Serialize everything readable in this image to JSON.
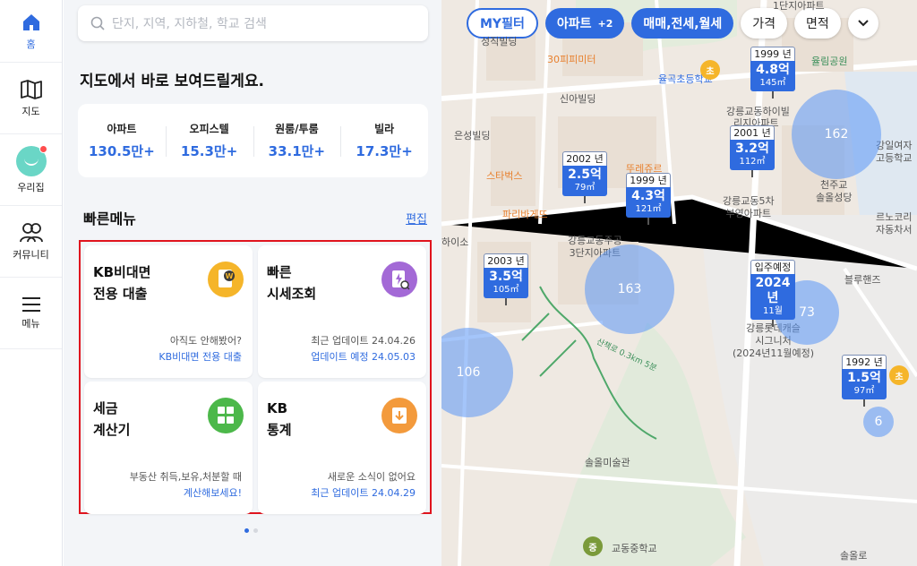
{
  "nav": {
    "items": [
      {
        "label": "홈",
        "icon": "home-icon"
      },
      {
        "label": "지도",
        "icon": "map-icon"
      },
      {
        "label": "우리집",
        "icon": "avatar"
      },
      {
        "label": "커뮤니티",
        "icon": "community-icon"
      },
      {
        "label": "메뉴",
        "icon": "menu-icon"
      }
    ]
  },
  "search": {
    "placeholder": "단지, 지역, 지하철, 학교 검색"
  },
  "headline": "지도에서 바로 보여드릴게요.",
  "stats": [
    {
      "label": "아파트",
      "value": "130.5만+"
    },
    {
      "label": "오피스텔",
      "value": "15.3만+"
    },
    {
      "label": "원룸/투룸",
      "value": "33.1만+"
    },
    {
      "label": "빌라",
      "value": "17.3만+"
    }
  ],
  "quick": {
    "title": "빠른메뉴",
    "edit_label": "편집",
    "cards": [
      {
        "title": "KB비대면\n전용 대출",
        "sub1": "아직도 안해봤어?",
        "sub2": "KB비대면 전용 대출",
        "icon": "loan-icon",
        "color": "#f5b52a"
      },
      {
        "title": "빠른\n시세조회",
        "sub1": "최근 업데이트 24.04.26",
        "sub2": "업데이트 예정 24.05.03",
        "icon": "price-lookup-icon",
        "color": "#a369d6"
      },
      {
        "title": "세금\n계산기",
        "sub1": "부동산 취득,보유,처분할 때",
        "sub2": "계산해보세요!",
        "icon": "calculator-icon",
        "color": "#4cb84a"
      },
      {
        "title": "KB\n통계",
        "sub1": "새로운 소식이 없어요",
        "sub2": "최근 업데이트 24.04.29",
        "icon": "statistics-icon",
        "color": "#f39a3c"
      }
    ]
  },
  "map": {
    "filters": [
      {
        "label": "MY필터",
        "style": "outline"
      },
      {
        "label": "아파트",
        "count": "+2",
        "style": "solid"
      },
      {
        "label": "매매,전세,월세",
        "style": "solid"
      },
      {
        "label": "가격",
        "style": "white"
      },
      {
        "label": "면적",
        "style": "white"
      }
    ],
    "pins": [
      {
        "year": "1999 년",
        "price": "4.8억",
        "area": "145㎡"
      },
      {
        "year": "2001 년",
        "price": "3.2억",
        "area": "112㎡"
      },
      {
        "year": "2002 년",
        "price": "2.5억",
        "area": "79㎡"
      },
      {
        "year": "1999 년",
        "price": "4.3억",
        "area": "121㎡"
      },
      {
        "year": "2003 년",
        "price": "3.5억",
        "area": "105㎡"
      },
      {
        "year": "입주예정",
        "price": "2024년",
        "area": "11월"
      },
      {
        "year": "1992 년",
        "price": "1.5억",
        "area": "97㎡"
      }
    ],
    "clusters": [
      "162",
      "163",
      "73",
      "106",
      "6"
    ],
    "labels": [
      {
        "text": "성직빌딩"
      },
      {
        "text": "30피피미터"
      },
      {
        "text": "율곡초등학교"
      },
      {
        "text": "1단지아파트"
      },
      {
        "text": "율림공원"
      },
      {
        "text": "신아빌딩"
      },
      {
        "text": "강릉교동하이빌"
      },
      {
        "text": "리지아파트"
      },
      {
        "text": "은성빌딩"
      },
      {
        "text": "강일여자\n고등학교"
      },
      {
        "text": "스타벅스"
      },
      {
        "text": "뚜레쥬르"
      },
      {
        "text": "파리바게뜨"
      },
      {
        "text": "강릉교동5차\n부영아파트"
      },
      {
        "text": "천주교\n솔올성당"
      },
      {
        "text": "르노코리\n자동차서"
      },
      {
        "text": "강릉교동주공\n3단지아파트"
      },
      {
        "text": "하이소"
      },
      {
        "text": "블루핸즈"
      },
      {
        "text": "강릉롯데캐슬\n시그니처\n(2024년11월예정)"
      },
      {
        "text": "솔올미술관"
      },
      {
        "text": "교동중학교"
      },
      {
        "text": "솔올로"
      },
      {
        "text": "산책로 0.3km 5분"
      }
    ],
    "school_badges": [
      "초",
      "초",
      "중"
    ]
  }
}
